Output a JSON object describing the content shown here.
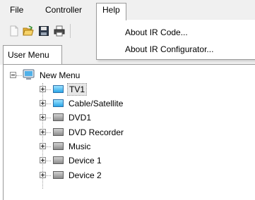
{
  "menubar": {
    "items": [
      {
        "label": "File"
      },
      {
        "label": "Controller"
      },
      {
        "label": "Help"
      }
    ]
  },
  "toolbar": {
    "buttons": [
      {
        "icon": "new-file-icon"
      },
      {
        "icon": "open-folder-icon"
      },
      {
        "icon": "save-disk-icon"
      },
      {
        "icon": "printer-icon"
      }
    ]
  },
  "help_menu": {
    "items": [
      {
        "label": "About IR Code..."
      },
      {
        "label": "About IR Configurator..."
      }
    ]
  },
  "tabs": [
    {
      "label": "User Menu"
    }
  ],
  "tree": {
    "root": {
      "label": "New Menu",
      "expanded": true,
      "icon": "monitor-icon"
    },
    "children": [
      {
        "label": "TV1",
        "icon": "tv-device-icon",
        "selected": true
      },
      {
        "label": "Cable/Satellite",
        "icon": "tv-device-icon"
      },
      {
        "label": "DVD1",
        "icon": "player-device-icon"
      },
      {
        "label": "DVD Recorder",
        "icon": "player-device-icon"
      },
      {
        "label": "Music",
        "icon": "player-device-icon"
      },
      {
        "label": "Device 1",
        "icon": "player-device-icon"
      },
      {
        "label": "Device 2",
        "icon": "player-device-icon"
      }
    ]
  },
  "colors": {
    "menubar_bg": "#f0f0f0",
    "tv_icon": "#2aa6e8",
    "device_icon": "#8d8d8d"
  }
}
